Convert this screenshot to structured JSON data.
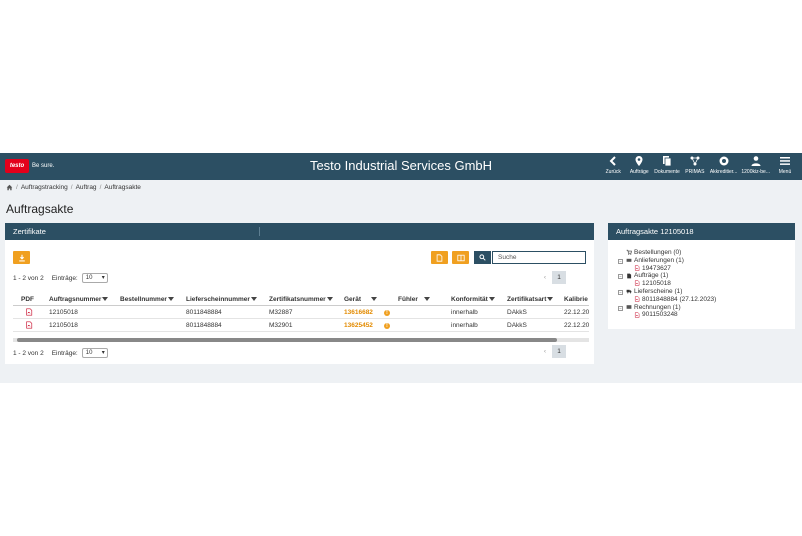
{
  "header": {
    "logo_text": "testo",
    "logo_slogan": "Be sure.",
    "title": "Testo Industrial Services GmbH",
    "nav": [
      {
        "label": "Zurück",
        "icon": "back-icon"
      },
      {
        "label": "Aufträge",
        "icon": "location-pin-icon"
      },
      {
        "label": "Dokumente",
        "icon": "documents-icon"
      },
      {
        "label": "PRIMAS",
        "icon": "network-icon"
      },
      {
        "label": "Akkreditier...",
        "icon": "seal-icon"
      },
      {
        "label": "1200kiz-be...",
        "icon": "user-icon"
      },
      {
        "label": "Menü",
        "icon": "hamburger-icon"
      }
    ]
  },
  "breadcrumb": [
    "Auftragstracking",
    "Auftrag",
    "Auftragsakte"
  ],
  "page_title": "Auftragsakte",
  "certificates": {
    "title": "Zertifikate",
    "search_placeholder": "Suche",
    "count_text": "1 - 2 von 2",
    "entries_label": "Einträge:",
    "entries_value": "10",
    "current_page": "1",
    "columns": [
      "PDF",
      "Auftragsnummer",
      "Bestellnummer",
      "Lieferscheinnummer",
      "Zertifikatsnummer",
      "Gerät",
      "Fühler",
      "Konformität",
      "Zertifikatsart",
      "Kalibrie"
    ],
    "rows": [
      {
        "auftrag": "12105018",
        "lieferschein": "8011848884",
        "zertifikat": "M32887",
        "geraet": "13616682",
        "konformitaet": "innerhalb",
        "art": "DAkkS",
        "datum": "22.12.20"
      },
      {
        "auftrag": "12105018",
        "lieferschein": "8011848884",
        "zertifikat": "M32901",
        "geraet": "13625452",
        "konformitaet": "innerhalb",
        "art": "DAkkS",
        "datum": "22.12.20"
      }
    ]
  },
  "order_file": {
    "title": "Auftragsakte 12105018",
    "tree": [
      {
        "label": "Bestellungen (0)",
        "kind": "cart",
        "toggle": ""
      },
      {
        "label": "Anlieferungen (1)",
        "kind": "folder",
        "toggle": "⊟"
      },
      {
        "label": "19473627",
        "kind": "pdf",
        "toggle": "",
        "child": true
      },
      {
        "label": "Aufträge (1)",
        "kind": "doc",
        "toggle": "⊟"
      },
      {
        "label": "12105018",
        "kind": "pdf",
        "toggle": "",
        "child": true
      },
      {
        "label": "Lieferscheine (1)",
        "kind": "truck",
        "toggle": "⊟"
      },
      {
        "label": "8011848884 (27.12.2023)",
        "kind": "pdf",
        "toggle": "",
        "child": true
      },
      {
        "label": "Rechnungen (1)",
        "kind": "euro",
        "toggle": "⊟"
      },
      {
        "label": "9011503248",
        "kind": "pdf",
        "toggle": "",
        "child": true
      }
    ]
  },
  "colors": {
    "brand": "#2c4f63",
    "accent": "#f0a020",
    "logo_red": "#e3001b"
  }
}
